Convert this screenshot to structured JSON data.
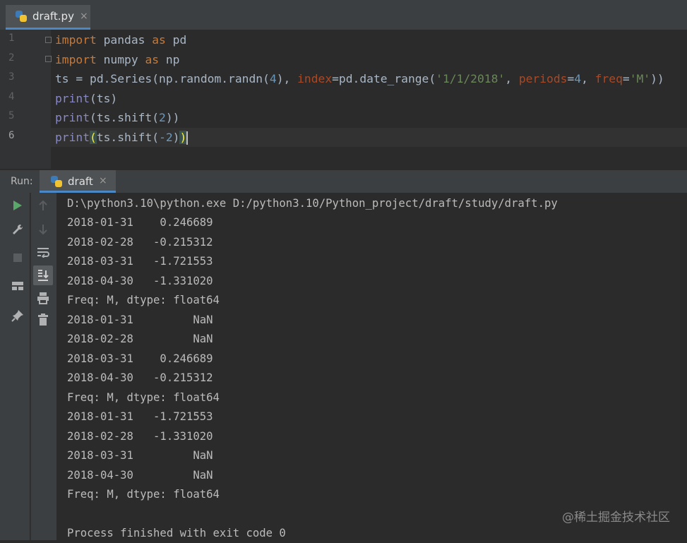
{
  "editor_tab": {
    "filename": "draft.py",
    "close": "×"
  },
  "code": {
    "line_numbers": [
      "1",
      "2",
      "3",
      "4",
      "5",
      "6"
    ],
    "line1": {
      "kw1": "import",
      "mod": " pandas ",
      "kw2": "as",
      "alias": " pd"
    },
    "line2": {
      "kw1": "import",
      "mod": " numpy ",
      "kw2": "as",
      "alias": " np"
    },
    "line3": {
      "a": "ts = pd.Series(np.random.randn(",
      "n4": "4",
      "b": "), ",
      "p_index": "index",
      "c": "=pd.date_range(",
      "s_date": "'1/1/2018'",
      "d": ", ",
      "p_periods": "periods",
      "e": "=",
      "n4b": "4",
      "f": ", ",
      "p_freq": "freq",
      "g": "=",
      "s_freq": "'M'",
      "h": "))"
    },
    "line4": {
      "fn": "print",
      "rest": "(ts)"
    },
    "line5": {
      "fn": "print",
      "a": "(ts.shift(",
      "num": "2",
      "b": "))"
    },
    "line6": {
      "fn": "print",
      "open": "(",
      "a": "ts.shift(",
      "num": "-2",
      "b": ")",
      "close": ")"
    }
  },
  "run_panel": {
    "title": "Run:",
    "tab_label": "draft",
    "tab_close": "×",
    "console": [
      "D:\\python3.10\\python.exe D:/python3.10/Python_project/draft/study/draft.py",
      "2018-01-31    0.246689",
      "2018-02-28   -0.215312",
      "2018-03-31   -1.721553",
      "2018-04-30   -1.331020",
      "Freq: M, dtype: float64",
      "2018-01-31         NaN",
      "2018-02-28         NaN",
      "2018-03-31    0.246689",
      "2018-04-30   -0.215312",
      "Freq: M, dtype: float64",
      "2018-01-31   -1.721553",
      "2018-02-28   -1.331020",
      "2018-03-31         NaN",
      "2018-04-30         NaN",
      "Freq: M, dtype: float64",
      "",
      "Process finished with exit code 0"
    ]
  },
  "watermark": "@稀土掘金技术社区",
  "colors": {
    "keyword": "#cc7832",
    "builtin": "#8888c6",
    "number": "#6897bb",
    "string": "#6a8759",
    "param": "#aa4926",
    "run_green": "#59a869"
  }
}
